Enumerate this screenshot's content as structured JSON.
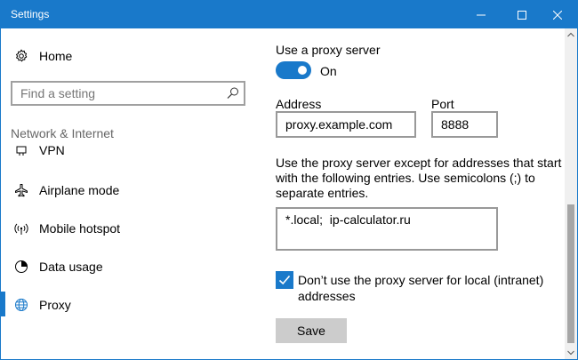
{
  "window": {
    "title": "Settings"
  },
  "sidebar": {
    "home_label": "Home",
    "search_placeholder": "Find a setting",
    "section_heading": "Network & Internet",
    "items": [
      {
        "label": "VPN",
        "icon": "vpn-icon",
        "active": false
      },
      {
        "label": "Airplane mode",
        "icon": "airplane-icon",
        "active": false
      },
      {
        "label": "Mobile hotspot",
        "icon": "hotspot-icon",
        "active": false
      },
      {
        "label": "Data usage",
        "icon": "data-usage-icon",
        "active": false
      },
      {
        "label": "Proxy",
        "icon": "globe-icon",
        "active": true
      }
    ]
  },
  "proxy": {
    "use_proxy_label": "Use a proxy server",
    "toggle_state": "On",
    "address_label": "Address",
    "address_value": "proxy.example.com",
    "port_label": "Port",
    "port_value": "8888",
    "exceptions_line1": "Use the proxy server except for addresses that start",
    "exceptions_line2": "with the following entries. Use semicolons (;) to",
    "exceptions_line3": "separate entries.",
    "exceptions_value": "*.local;  ip-calculator.ru",
    "local_checkbox_line1": "Don’t use the proxy server for local (intranet)",
    "local_checkbox_line2": "addresses",
    "local_checkbox_checked": true,
    "save_label": "Save"
  },
  "colors": {
    "accent": "#1979ca",
    "button_gray": "#cccccc",
    "heading_gray": "#666666"
  }
}
